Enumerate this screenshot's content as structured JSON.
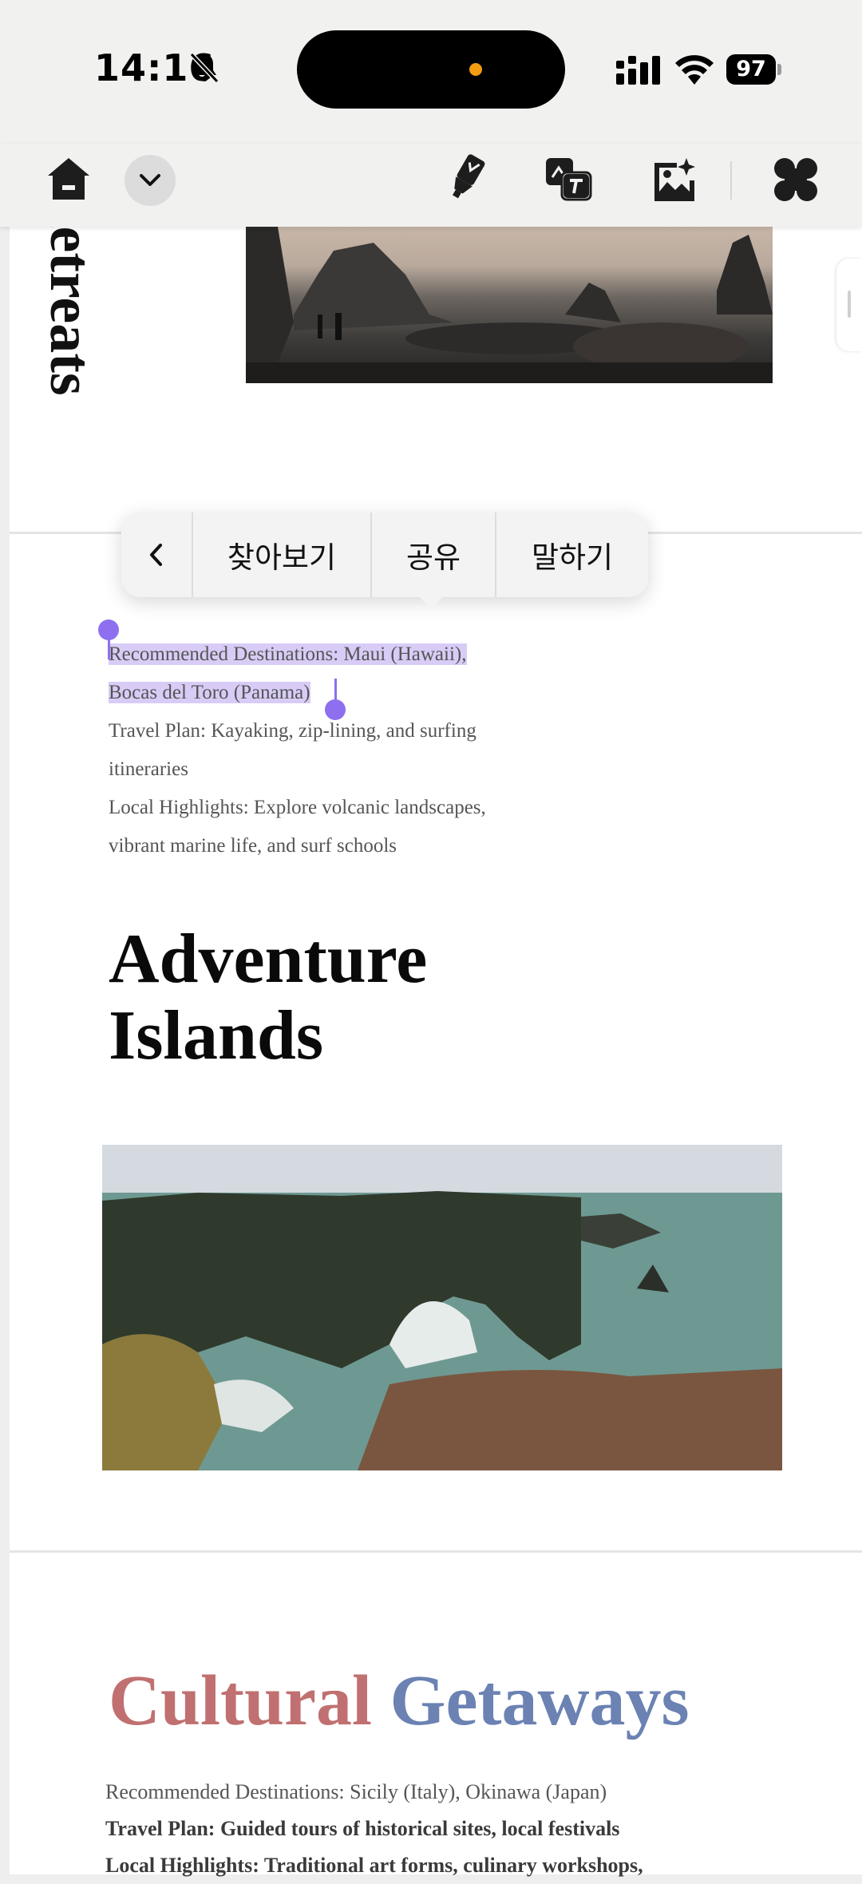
{
  "status_bar": {
    "time": "14:16",
    "battery_level": "97",
    "icons": [
      "bell-slash-icon",
      "signal-icon",
      "wifi-icon",
      "battery-icon"
    ]
  },
  "toolbar": {
    "icons": [
      "home-icon",
      "chevron-down-icon",
      "highlighter-icon",
      "translate-icon",
      "photo-edit-icon",
      "apps-icon"
    ]
  },
  "document": {
    "partial_heading": "Retreats",
    "selection": {
      "line1": "Recommended Destinations: Maui (Hawaii),",
      "line2": "Bocas del Toro (Panama)"
    },
    "adventure_lines": [
      "Travel Plan: Kayaking, zip-lining, and surfing",
      "itineraries",
      "Local Highlights: Explore volcanic landscapes,",
      "vibrant marine life, and surf schools"
    ],
    "adventure_heading_1": "Adventure",
    "adventure_heading_2": "Islands",
    "cultural_heading_a": "Cultural",
    "cultural_heading_b": "Getaways",
    "cultural_lines": [
      "Recommended Destinations: Sicily (Italy), Okinawa (Japan)",
      "Travel Plan: Guided tours of historical sites, local festivals",
      "Local Highlights: Traditional art forms, culinary workshops,"
    ]
  },
  "context_menu": {
    "back": "<",
    "find": "찾아보기",
    "share": "공유",
    "speak": "말하기"
  },
  "colors": {
    "selection": "#d8ccf7",
    "handle": "#8d6ff0",
    "cultural_red": "#c07070",
    "cultural_blue": "#6b82b3"
  }
}
